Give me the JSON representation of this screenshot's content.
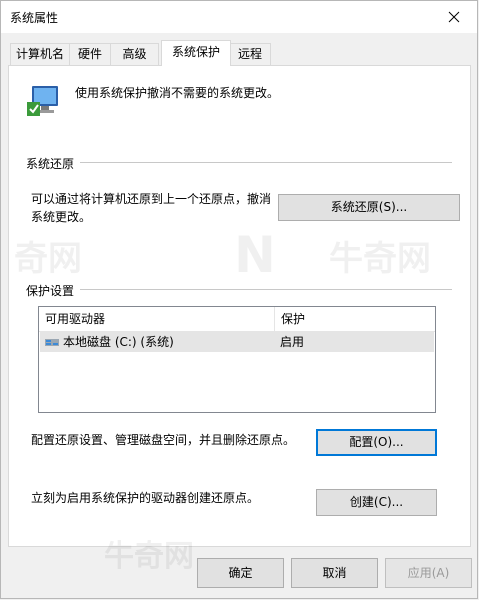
{
  "window": {
    "title": "系统属性"
  },
  "tabs": [
    {
      "label": "计算机名"
    },
    {
      "label": "硬件"
    },
    {
      "label": "高级"
    },
    {
      "label": "系统保护"
    },
    {
      "label": "远程"
    }
  ],
  "intro": {
    "text": "使用系统保护撤消不需要的系统更改。"
  },
  "restore": {
    "group_label": "系统还原",
    "description_line1": "可以通过将计算机还原到上一个还原点，撤消",
    "description_line2": "系统更改。",
    "button_label": "系统还原(S)..."
  },
  "protection": {
    "group_label": "保护设置",
    "columns": [
      "可用驱动器",
      "保护"
    ],
    "rows": [
      {
        "drive": "本地磁盘 (C:) (系统)",
        "status": "启用"
      }
    ],
    "configure_text": "配置还原设置、管理磁盘空间，并且删除还原点。",
    "configure_button": "配置(O)...",
    "create_text": "立刻为启用系统保护的驱动器创建还原点。",
    "create_button": "创建(C)..."
  },
  "footer": {
    "ok": "确定",
    "cancel": "取消",
    "apply": "应用(A)"
  },
  "colors": {
    "focus_border": "#0078d7",
    "panel_bg": "#ffffff",
    "window_bg": "#f0f0f0"
  },
  "icons": [
    "close-icon",
    "system-protection-icon",
    "drive-icon"
  ]
}
